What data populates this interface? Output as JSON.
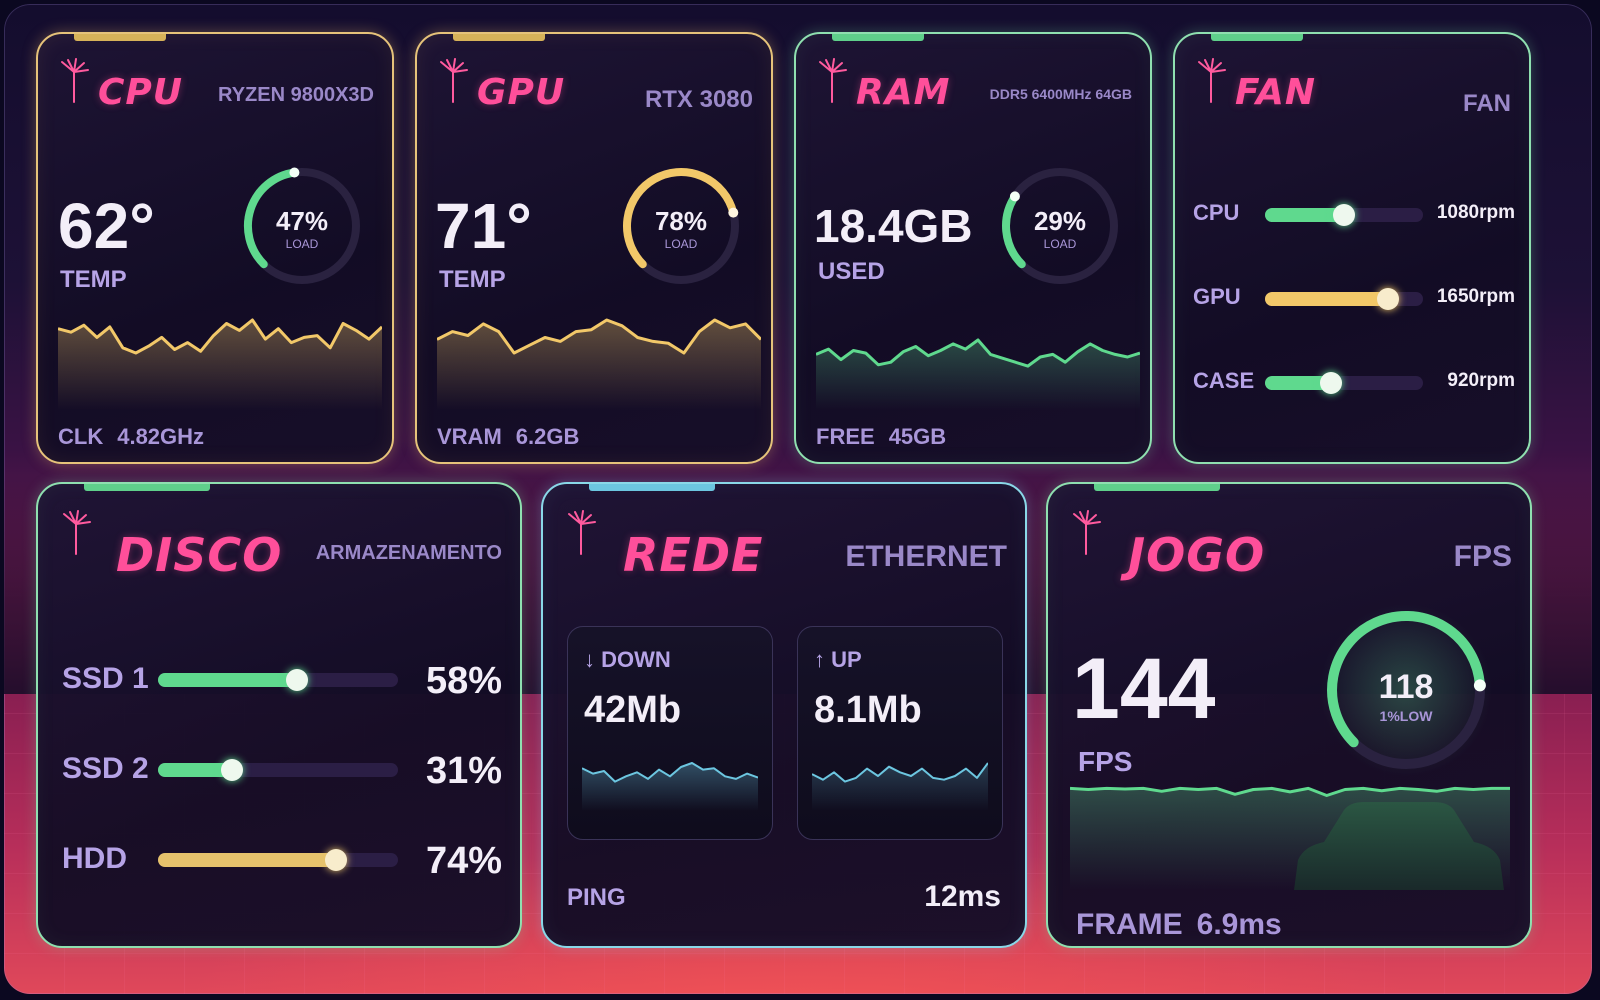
{
  "colors": {
    "pink_title": "#ff4f9a",
    "gold": "#f2c869",
    "green": "#5fd98e",
    "cyan": "#6cc6e0",
    "muted": "#b6a3e6"
  },
  "cpu": {
    "title": "CPU",
    "model": "RYZEN 9800X3D",
    "temp": "62°",
    "temp_label": "TEMP",
    "load": "47%",
    "load_fraction": 0.47,
    "load_label": "LOAD",
    "footer_label": "CLK",
    "footer_value": "4.82GHz",
    "history": [
      52,
      50,
      54,
      47,
      53,
      41,
      38,
      42,
      47,
      40,
      44,
      39,
      48,
      55,
      51,
      57,
      46,
      52,
      44,
      47,
      48,
      41,
      55,
      51,
      46,
      53
    ]
  },
  "gpu": {
    "title": "GPU",
    "model": "RTX 3080",
    "temp": "71°",
    "temp_label": "TEMP",
    "load": "78%",
    "load_fraction": 0.78,
    "load_label": "LOAD",
    "footer_label": "VRAM",
    "footer_value": "6.2GB",
    "history": [
      48,
      52,
      50,
      56,
      52,
      41,
      45,
      49,
      47,
      52,
      53,
      58,
      55,
      49,
      47,
      46,
      41,
      52,
      58,
      54,
      56,
      48
    ]
  },
  "ram": {
    "title": "RAM",
    "model": "DDR5 6400MHz 64GB",
    "used": "18.4GB",
    "used_label": "USED",
    "load": "29%",
    "load_fraction": 0.29,
    "load_label": "LOAD",
    "footer_label": "FREE",
    "footer_value": "45GB",
    "history": [
      44,
      48,
      40,
      47,
      45,
      36,
      38,
      46,
      50,
      43,
      47,
      52,
      48,
      55,
      44,
      41,
      38,
      35,
      42,
      44,
      38,
      46,
      52,
      47,
      44,
      42,
      45
    ]
  },
  "fan": {
    "title": "FAN",
    "subtitle": "FAN",
    "rows": [
      {
        "label": "CPU",
        "value": "1080rpm",
        "fraction": 0.5,
        "color": "#5fd98e"
      },
      {
        "label": "GPU",
        "value": "1650rpm",
        "fraction": 0.78,
        "color": "#f2c869"
      },
      {
        "label": "CASE",
        "value": "920rpm",
        "fraction": 0.42,
        "color": "#5fd98e"
      }
    ]
  },
  "disco": {
    "title": "DISCO",
    "subtitle": "ARMAZENAMENTO",
    "rows": [
      {
        "label": "SSD 1",
        "value": "58%",
        "fraction": 0.58,
        "color": "#5fd98e"
      },
      {
        "label": "SSD 2",
        "value": "31%",
        "fraction": 0.31,
        "color": "#5fd98e"
      },
      {
        "label": "HDD",
        "value": "74%",
        "fraction": 0.74,
        "color": "#e6c26c"
      }
    ]
  },
  "rede": {
    "title": "REDE",
    "subtitle": "ETHERNET",
    "down_label": "↓ DOWN",
    "down_value": "42Mb",
    "down_history": [
      44,
      40,
      42,
      34,
      38,
      41,
      36,
      43,
      38,
      45,
      48,
      43,
      44,
      38,
      36,
      40,
      37
    ],
    "up_label": "↑ UP",
    "up_value": "8.1Mb",
    "up_history": [
      30,
      27,
      31,
      26,
      28,
      33,
      29,
      34,
      31,
      29,
      33,
      28,
      27,
      29,
      33,
      28,
      36
    ],
    "ping_label": "PING",
    "ping_value": "12ms"
  },
  "jogo": {
    "title": "JOGO",
    "subtitle": "FPS",
    "fps": "144",
    "fps_label": "FPS",
    "low": "118",
    "low_label": "1%LOW",
    "low_fraction": 0.82,
    "footer_label": "FRAME",
    "footer_value": "6.9ms",
    "history": [
      60,
      58,
      60,
      59,
      60,
      55,
      60,
      58,
      60,
      50,
      58,
      60,
      54,
      60,
      48,
      58,
      60,
      56,
      60,
      58,
      55,
      60,
      58,
      60,
      60
    ]
  }
}
